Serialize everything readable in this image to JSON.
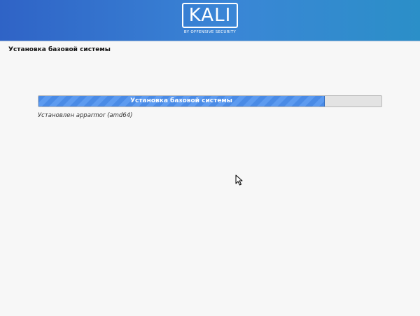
{
  "brand": {
    "logo_text": "KALI",
    "logo_subtitle": "BY OFFENSIVE SECURITY"
  },
  "page": {
    "title": "Установка базовой системы"
  },
  "progress": {
    "label": "Установка базовой системы",
    "fraction": 0.832,
    "status": "Установлен apparmor (amd64)"
  },
  "colors": {
    "banner": "#3a86d6",
    "progress_fill": "#4a8be6",
    "progress_track": "#e3e3e3"
  },
  "icons": {
    "cursor": "mouse-pointer-icon"
  }
}
